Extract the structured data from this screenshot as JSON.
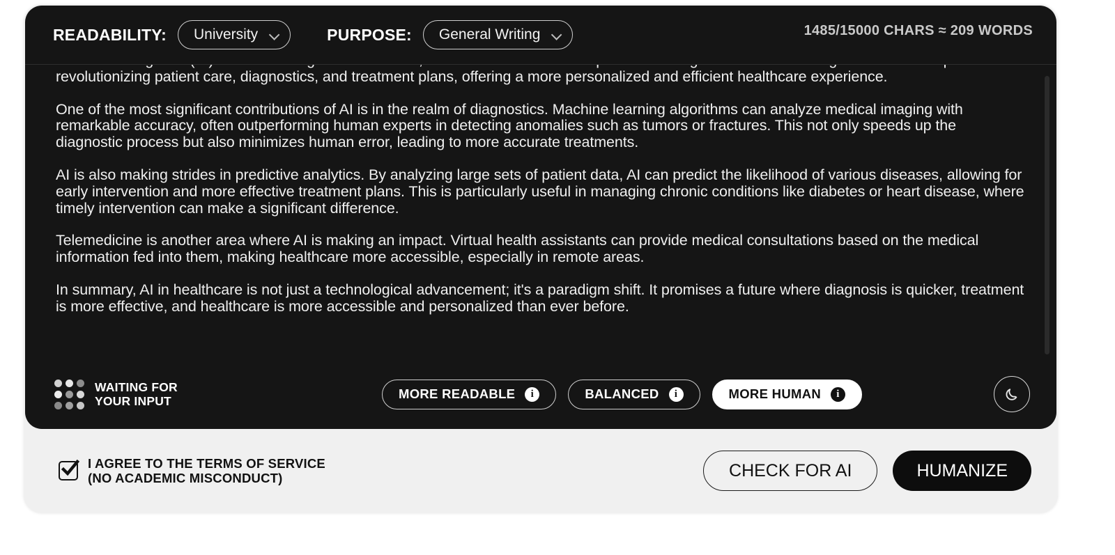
{
  "header": {
    "readability_label": "READABILITY:",
    "readability_value": "University",
    "purpose_label": "PURPOSE:",
    "purpose_value": "General Writing",
    "char_counter": "1485/15000 CHARS ≈ 209 WORDS"
  },
  "text_body": {
    "paragraphs": [
      "Artificial intelligence (AI) is transforming various sectors, and healthcare is no exception. The integration of AI technologies into medical practices is revolutionizing patient care, diagnostics, and treatment plans, offering a more personalized and efficient healthcare experience.",
      "One of the most significant contributions of AI is in the realm of diagnostics. Machine learning algorithms can analyze medical imaging with remarkable accuracy, often outperforming human experts in detecting anomalies such as tumors or fractures. This not only speeds up the diagnostic process but also minimizes human error, leading to more accurate treatments.",
      "AI is also making strides in predictive analytics. By analyzing large sets of patient data, AI can predict the likelihood of various diseases, allowing for early intervention and more effective treatment plans. This is particularly useful in managing chronic conditions like diabetes or heart disease, where timely intervention can make a significant difference.",
      "Telemedicine is another area where AI is making an impact. Virtual health assistants can provide medical consultations based on the medical information fed into them, making healthcare more accessible, especially in remote areas.",
      "In summary, AI in healthcare is not just a technological advancement; it's a paradigm shift. It promises a future where diagnosis is quicker, treatment is more effective, and healthcare is more accessible and personalized than ever before."
    ]
  },
  "toolbar": {
    "status_text": "WAITING FOR\nYOUR INPUT",
    "dot_shades": [
      "#d2d2d2",
      "#e8e8e8",
      "#8d8d8d",
      "#eeeeee",
      "#9a9a9a",
      "#d9d9d9",
      "#8a8a8a",
      "#9f9f9f",
      "#c6c6c6"
    ],
    "modes": [
      {
        "label": "MORE READABLE",
        "info": "i",
        "active": false
      },
      {
        "label": "BALANCED",
        "info": "i",
        "active": false
      },
      {
        "label": "MORE HUMAN",
        "info": "i",
        "active": true
      }
    ],
    "theme_toggle_icon": "moon-icon"
  },
  "bottom_bar": {
    "terms_text": "I AGREE TO THE TERMS OF SERVICE\n(NO ACADEMIC MISCONDUCT)",
    "terms_checked": true,
    "check_ai_label": "CHECK FOR AI",
    "humanize_label": "HUMANIZE"
  },
  "colors": {
    "panel_background": "#151515",
    "card_background": "#f0f0f0",
    "accent": "#ffffff",
    "primary_button": "#0d0d0d"
  }
}
